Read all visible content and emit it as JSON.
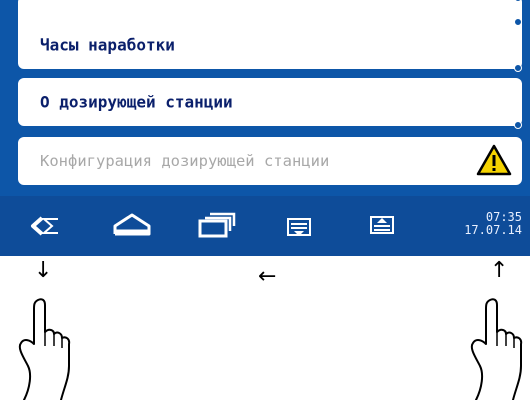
{
  "menu": {
    "items": [
      {
        "label": "Часы наработки",
        "enabled": true
      },
      {
        "label": "О дозирующей станции",
        "enabled": true
      },
      {
        "label": "Конфигурация дозирующей станции",
        "enabled": false,
        "status_icon": "warning-icon"
      }
    ]
  },
  "navbar": {
    "buttons": [
      {
        "icon": "back-icon"
      },
      {
        "icon": "home-icon"
      },
      {
        "icon": "windows-icon"
      },
      {
        "icon": "menu-down-icon"
      },
      {
        "icon": "menu-up-icon"
      }
    ],
    "time": "07:35",
    "date": "17.07.14"
  },
  "annotations": {
    "arrows": [
      "↓",
      "←",
      "↑"
    ],
    "hands": [
      "pointing-hand-icon",
      "pointing-hand-icon"
    ]
  },
  "colors": {
    "screen_bg": "#0d56a8",
    "navbar_bg": "#0e4c99",
    "label_text": "#0a1f6b",
    "disabled_text": "#a8a8a8"
  }
}
